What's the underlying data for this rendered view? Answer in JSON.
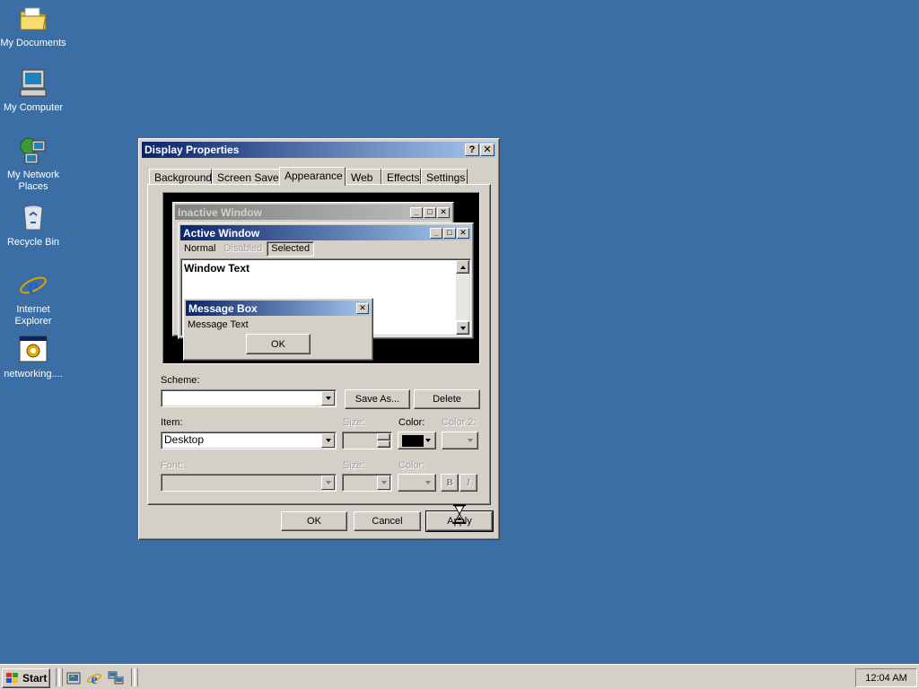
{
  "desktop": {
    "icons": [
      {
        "label": "My Documents"
      },
      {
        "label": "My Computer"
      },
      {
        "label": "My Network Places"
      },
      {
        "label": "Recycle Bin"
      },
      {
        "label": "Internet Explorer"
      },
      {
        "label": "networking...."
      }
    ]
  },
  "dialog": {
    "title": "Display Properties",
    "help_btn": "?",
    "close_btn": "✕",
    "tabs": [
      "Background",
      "Screen Saver",
      "Appearance",
      "Web",
      "Effects",
      "Settings"
    ],
    "active_tab": "Appearance",
    "preview": {
      "inactive_title": "Inactive Window",
      "active_title": "Active Window",
      "menu": [
        "Normal",
        "Disabled",
        "Selected"
      ],
      "window_text": "Window Text",
      "msgbox_title": "Message Box",
      "msgbox_text": "Message Text",
      "msgbox_ok": "OK"
    },
    "scheme_label": "Scheme:",
    "scheme_value": "",
    "save_as": "Save As...",
    "delete": "Delete",
    "item_label": "Item:",
    "item_value": "Desktop",
    "size_label": "Size:",
    "color_label": "Color:",
    "color2_label": "Color 2:",
    "font_label": "Font:",
    "font_size_label": "Size:",
    "font_color_label": "Color:",
    "bold": "B",
    "italic": "I",
    "ok": "OK",
    "cancel": "Cancel",
    "apply": "Apply",
    "color_swatch": "#000000"
  },
  "taskbar": {
    "start": "Start",
    "clock": "12:04 AM"
  },
  "colors": {
    "desktop": "#3a6ea5",
    "active_title": "#0a246a",
    "inactive_title": "#808080"
  }
}
